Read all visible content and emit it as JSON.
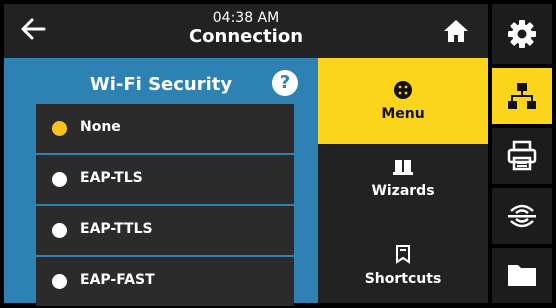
{
  "header": {
    "time": "04:38 AM",
    "title": "Connection"
  },
  "panel": {
    "title": "Wi-Fi Security",
    "help_label": "?",
    "options": [
      {
        "label": "None",
        "selected": true
      },
      {
        "label": "EAP-TLS",
        "selected": false
      },
      {
        "label": "EAP-TTLS",
        "selected": false
      },
      {
        "label": "EAP-FAST",
        "selected": false
      }
    ]
  },
  "menu_column": {
    "menu_label": "Menu",
    "wizards_label": "Wizards",
    "shortcuts_label": "Shortcuts"
  },
  "sidebar": {
    "items": [
      "settings-icon",
      "network-icon",
      "printer-icon",
      "rfid-icon",
      "folder-icon"
    ],
    "active": "network-icon"
  },
  "colors": {
    "accent": "#fbd41c",
    "panel_blue": "#2d81b3",
    "radio_selected": "#f7c21b"
  }
}
